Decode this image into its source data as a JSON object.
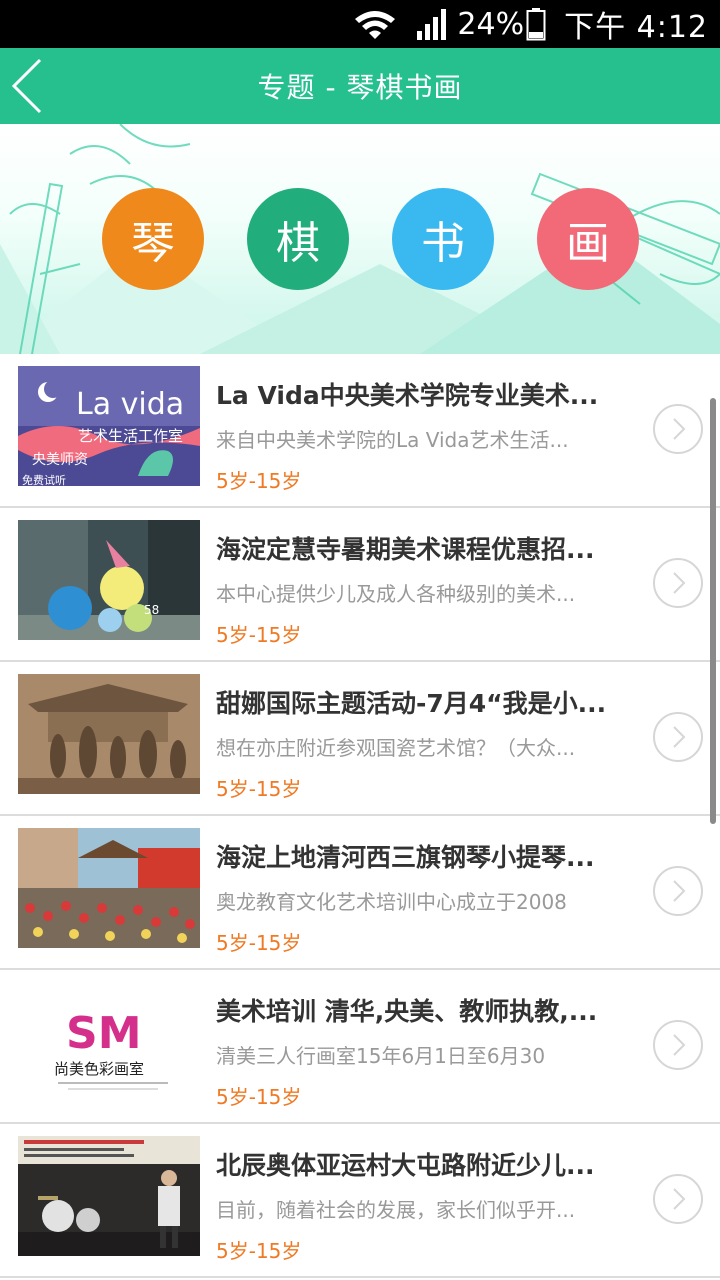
{
  "statusbar": {
    "battery_percent": "24%",
    "time": "下午 4:12"
  },
  "header": {
    "title": "专题 - 琴棋书画"
  },
  "categories": [
    {
      "label": "琴",
      "color": "#f0891c"
    },
    {
      "label": "棋",
      "color": "#22ad7c"
    },
    {
      "label": "书",
      "color": "#3ab9f0"
    },
    {
      "label": "画",
      "color": "#f26a78"
    }
  ],
  "courses": [
    {
      "title": "La Vida中央美术学院专业美术...",
      "desc": "来自中央美术学院的La Vida艺术生活...",
      "age": "5岁-15岁",
      "thumb_text": [
        "La vida",
        "艺术生活工作室",
        "央美师资",
        "免费试听"
      ]
    },
    {
      "title": "海淀定慧寺暑期美术课程优惠招...",
      "desc": "本中心提供少儿及成人各种级别的美术...",
      "age": "5岁-15岁",
      "thumb_text": [
        "58"
      ]
    },
    {
      "title": "甜娜国际主题活动-7月4“我是小...",
      "desc": "想在亦庄附近参观国瓷艺术馆？（大众...",
      "age": "5岁-15岁",
      "thumb_text": []
    },
    {
      "title": "海淀上地清河西三旗钢琴小提琴...",
      "desc": "奥龙教育文化艺术培训中心成立于2008",
      "age": "5岁-15岁",
      "thumb_text": []
    },
    {
      "title": "美术培训 清华,央美、教师执教,...",
      "desc": "清美三人行画室15年6月1日至6月30",
      "age": "5岁-15岁",
      "thumb_text": [
        "SM",
        "尚美色彩画室"
      ]
    },
    {
      "title": "北辰奥体亚运村大屯路附近少儿...",
      "desc": "目前，随着社会的发展，家长们似乎开...",
      "age": "5岁-15岁",
      "thumb_text": []
    }
  ]
}
